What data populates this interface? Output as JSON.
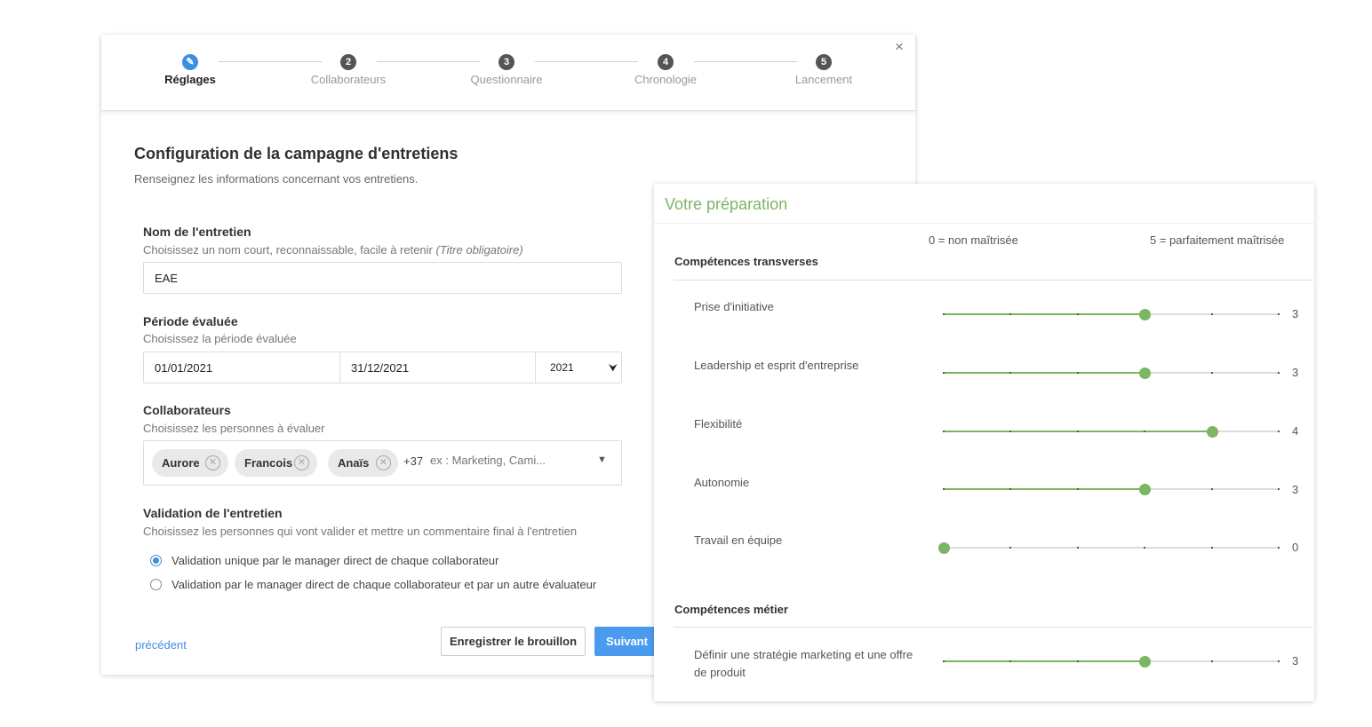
{
  "wizard": {
    "close_icon": "×",
    "steps": [
      {
        "number": "✎",
        "label": "Réglages",
        "active": true
      },
      {
        "number": "2",
        "label": "Collaborateurs",
        "active": false
      },
      {
        "number": "3",
        "label": "Questionnaire",
        "active": false
      },
      {
        "number": "4",
        "label": "Chronologie",
        "active": false
      },
      {
        "number": "5",
        "label": "Lancement",
        "active": false
      }
    ],
    "title": "Configuration de la campagne d'entretiens",
    "subtitle": "Renseignez les informations concernant vos entretiens.",
    "name_field": {
      "label": "Nom de l'entretien",
      "help": "Choisissez un nom court, reconnaissable, facile à retenir",
      "help_note": "(Titre obligatoire)",
      "value": "EAE"
    },
    "period_field": {
      "label": "Période évaluée",
      "help": "Choisissez la période évaluée",
      "start": "01/01/2021",
      "end": "31/12/2021",
      "year": "2021"
    },
    "collaborators_field": {
      "label": "Collaborateurs",
      "help": "Choisissez les personnes à évaluer",
      "chips": [
        "Aurore",
        "Francois",
        "Anaïs"
      ],
      "more": "+37",
      "placeholder": "ex : Marketing, Cami..."
    },
    "validation_field": {
      "label": "Validation de l'entretien",
      "help": "Choisissez les personnes qui vont valider et mettre un commentaire final à l'entretien",
      "options": [
        {
          "label": "Validation unique par le manager direct de chaque collaborateur",
          "checked": true
        },
        {
          "label": "Validation par le manager direct de chaque collaborateur et par un autre évaluateur",
          "checked": false
        }
      ]
    },
    "prev_label": "précédent",
    "draft_label": "Enregistrer le brouillon",
    "next_label": "Suivant"
  },
  "preparation": {
    "title": "Votre préparation",
    "scale_min": "0 = non maîtrisée",
    "scale_max": "5 = parfaitement maîtrisée",
    "scale_max_value": 5,
    "accent_color": "#7cb563",
    "sections": [
      {
        "title": "Compétences transverses",
        "skills": [
          {
            "label": "Prise d'initiative",
            "value": 3
          },
          {
            "label": "Leadership et esprit d'entreprise",
            "value": 3
          },
          {
            "label": "Flexibilité",
            "value": 4
          },
          {
            "label": "Autonomie",
            "value": 3
          },
          {
            "label": "Travail en équipe",
            "value": 0
          }
        ]
      },
      {
        "title": "Compétences métier",
        "skills": [
          {
            "label": "Définir une stratégie marketing et une offre de produit",
            "value": 3
          }
        ]
      }
    ]
  }
}
